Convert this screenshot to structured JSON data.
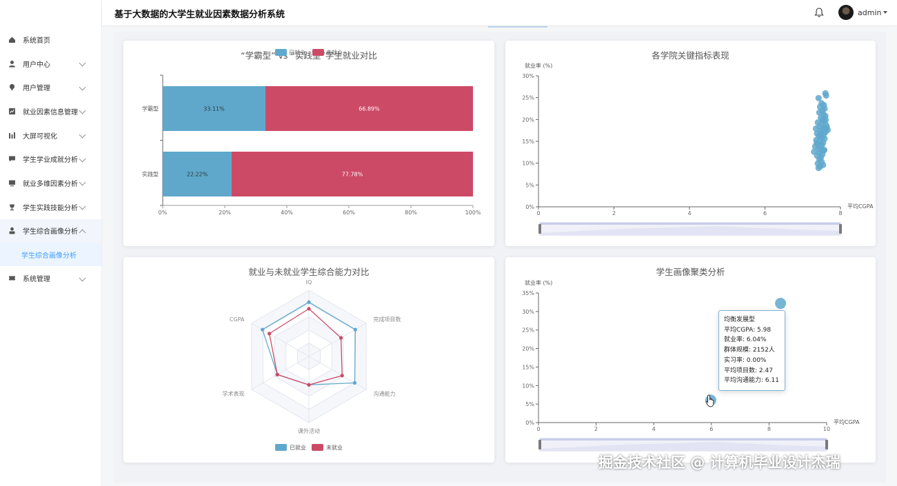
{
  "app": {
    "title": "基于大数据的大学生就业因素数据分析系统",
    "user": "admin"
  },
  "sidebar": {
    "items": [
      {
        "label": "系统首页",
        "icon": "home-icon"
      },
      {
        "label": "用户中心",
        "icon": "user-icon"
      },
      {
        "label": "用户管理",
        "icon": "location-icon"
      },
      {
        "label": "就业因素信息管理",
        "icon": "chart-icon"
      },
      {
        "label": "大屏可视化",
        "icon": "bar-icon"
      },
      {
        "label": "学生学业成就分析",
        "icon": "chat-icon"
      },
      {
        "label": "就业多维因素分析",
        "icon": "screen-icon"
      },
      {
        "label": "学生实践技能分析",
        "icon": "cup-icon"
      },
      {
        "label": "学生综合画像分析",
        "icon": "person-icon"
      },
      {
        "label": "系统管理",
        "icon": "ticket-icon"
      }
    ],
    "submenu": {
      "label": "学生综合画像分析"
    }
  },
  "charts": {
    "bar": {
      "title": "“学霸型” vs “实践型”学生就业对比",
      "legend": [
        "已就业",
        "未就业"
      ]
    },
    "scatter1": {
      "title": "各学院关键指标表现",
      "ylabel": "就业率 (%)",
      "xlabel": "平均CGPA"
    },
    "radar": {
      "title": "就业与未就业学生综合能力对比",
      "legend": [
        "已就业",
        "未就业"
      ]
    },
    "bubble": {
      "title": "学生画像聚类分析",
      "ylabel": "就业率 (%)",
      "xlabel": "平均CGPA"
    }
  },
  "tooltip": {
    "title": "均衡发展型",
    "lines": [
      "平均CGPA: 5.98",
      "就业率: 6.04%",
      "群体规模: 2152人",
      "实习率: 0.00%",
      "平均项目数: 2.47",
      "平均沟通能力: 6.11"
    ]
  },
  "watermark": "掘金技术社区 @ 计算机毕业设计杰瑞",
  "colors": {
    "employed": "#5fa8cc",
    "unemployed": "#cc4a66",
    "accent": "#409eff"
  },
  "chart_data": [
    {
      "type": "bar",
      "stacked": "percent",
      "orientation": "horizontal",
      "title": "“学霸型” vs “实践型”学生就业对比",
      "categories": [
        "学霸型",
        "实践型"
      ],
      "series": [
        {
          "name": "已就业",
          "values": [
            33.11,
            22.22
          ],
          "labels": [
            "33.11%",
            "22.22%"
          ]
        },
        {
          "name": "未就业",
          "values": [
            66.89,
            77.78
          ],
          "labels": [
            "66.89%",
            "77.78%"
          ]
        }
      ],
      "xticks": [
        "0%",
        "20%",
        "40%",
        "60%",
        "80%",
        "100%"
      ],
      "xlim": [
        0,
        100
      ]
    },
    {
      "type": "scatter",
      "title": "各学院关键指标表现",
      "xlabel": "平均CGPA",
      "ylabel": "就业率 (%)",
      "xlim": [
        0,
        8
      ],
      "ylim": [
        0,
        30
      ],
      "xticks": [
        "0",
        "2",
        "4",
        "6",
        "8"
      ],
      "yticks": [
        "0%",
        "5%",
        "10%",
        "15%",
        "20%",
        "25%",
        "30%"
      ],
      "points": [
        [
          7.6,
          26.0
        ],
        [
          7.62,
          25.5
        ],
        [
          7.42,
          24.9
        ],
        [
          7.5,
          23.7
        ],
        [
          7.56,
          23.3
        ],
        [
          7.46,
          22.9
        ],
        [
          7.58,
          22.5
        ],
        [
          7.52,
          22.0
        ],
        [
          7.44,
          21.6
        ],
        [
          7.55,
          21.2
        ],
        [
          7.6,
          20.8
        ],
        [
          7.48,
          20.4
        ],
        [
          7.53,
          20.0
        ],
        [
          7.57,
          19.6
        ],
        [
          7.4,
          19.3
        ],
        [
          7.5,
          19.0
        ],
        [
          7.62,
          18.7
        ],
        [
          7.45,
          18.4
        ],
        [
          7.58,
          18.1
        ],
        [
          7.35,
          17.9
        ],
        [
          7.52,
          17.7
        ],
        [
          7.47,
          17.4
        ],
        [
          7.6,
          17.1
        ],
        [
          7.38,
          16.8
        ],
        [
          7.55,
          16.5
        ],
        [
          7.43,
          16.2
        ],
        [
          7.5,
          15.9
        ],
        [
          7.58,
          15.6
        ],
        [
          7.36,
          15.3
        ],
        [
          7.46,
          15.0
        ],
        [
          7.54,
          14.7
        ],
        [
          7.4,
          14.4
        ],
        [
          7.51,
          14.1
        ],
        [
          7.33,
          13.8
        ],
        [
          7.48,
          13.5
        ],
        [
          7.42,
          13.2
        ],
        [
          7.56,
          12.9
        ],
        [
          7.3,
          12.6
        ],
        [
          7.45,
          12.3
        ],
        [
          7.52,
          12.0
        ],
        [
          7.38,
          11.7
        ],
        [
          7.48,
          11.3
        ],
        [
          7.44,
          10.8
        ],
        [
          7.5,
          10.3
        ],
        [
          7.4,
          9.9
        ],
        [
          7.54,
          9.6
        ],
        [
          7.46,
          9.2
        ],
        [
          7.42,
          8.9
        ],
        [
          7.64,
          18.2
        ],
        [
          7.66,
          17.6
        ],
        [
          7.61,
          19.9
        ],
        [
          7.49,
          16.6
        ],
        [
          7.37,
          14.6
        ],
        [
          7.57,
          13.0
        ]
      ]
    },
    {
      "type": "radar",
      "title": "就业与未就业学生综合能力对比",
      "indicators": [
        "IQ",
        "完成项目数",
        "沟通能力",
        "课外活动",
        "学术表现",
        "CGPA"
      ],
      "series": [
        {
          "name": "已就业",
          "values": [
            0.82,
            0.81,
            0.8,
            0.43,
            0.55,
            0.81
          ]
        },
        {
          "name": "未就业",
          "values": [
            0.72,
            0.56,
            0.58,
            0.43,
            0.55,
            0.69
          ]
        }
      ]
    },
    {
      "type": "scatter",
      "subtype": "bubble",
      "title": "学生画像聚类分析",
      "xlabel": "平均CGPA",
      "ylabel": "就业率 (%)",
      "xlim": [
        0,
        10
      ],
      "ylim": [
        0,
        35
      ],
      "xticks": [
        "0",
        "2",
        "4",
        "6",
        "8",
        "10"
      ],
      "yticks": [
        "0%",
        "5%",
        "10%",
        "15%",
        "20%",
        "25%",
        "30%",
        "35%"
      ],
      "points": [
        {
          "x": 8.4,
          "y": 32.2,
          "r": 8
        },
        {
          "x": 5.98,
          "y": 6.04,
          "r": 8
        }
      ]
    }
  ]
}
